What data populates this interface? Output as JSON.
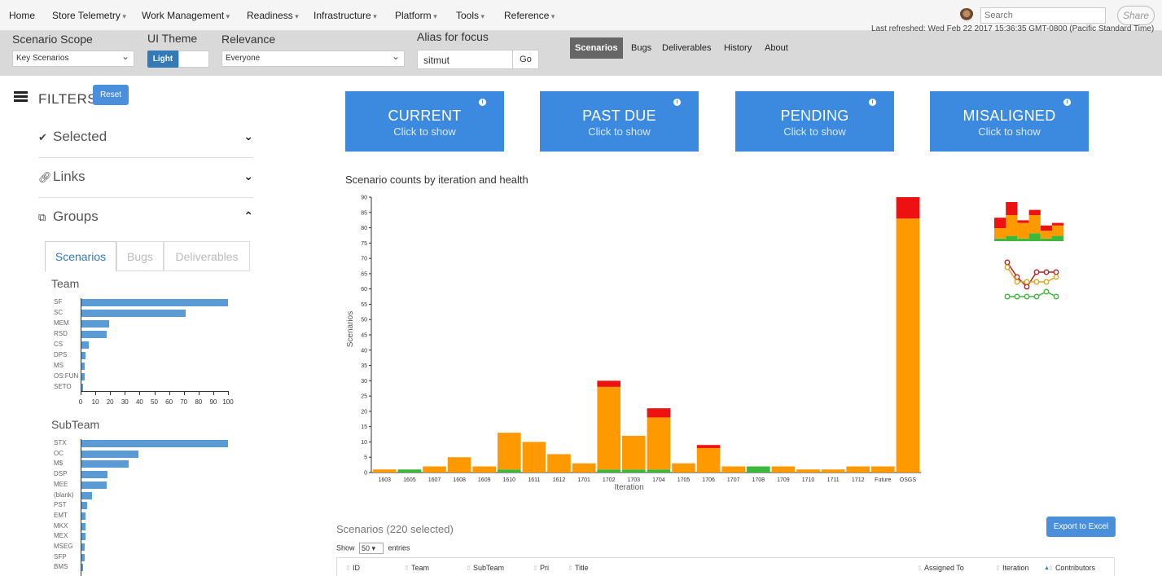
{
  "nav": {
    "items": [
      {
        "label": "Home",
        "dropdown": false
      },
      {
        "label": "Store Telemetry",
        "dropdown": true
      },
      {
        "label": "Work Management",
        "dropdown": true
      },
      {
        "label": "Readiness",
        "dropdown": true
      },
      {
        "label": "Infrastructure",
        "dropdown": true
      },
      {
        "label": "Platform",
        "dropdown": true
      },
      {
        "label": "Tools",
        "dropdown": true
      },
      {
        "label": "Reference",
        "dropdown": true
      }
    ],
    "search_placeholder": "Search",
    "share_label": "Share"
  },
  "toolbar": {
    "scope_label": "Scenario Scope",
    "scope_value": "Key Scenarios",
    "theme_label": "UI Theme",
    "theme_light": "Light",
    "relevance_label": "Relevance",
    "relevance_value": "Everyone",
    "alias_label": "Alias for focus",
    "alias_value": "sitmut",
    "go_label": "Go",
    "views": [
      "Scenarios",
      "Bugs",
      "Deliverables",
      "History",
      "About"
    ],
    "active_view": "Scenarios",
    "last_refreshed": "Last refreshed: Wed Feb 22 2017 15:36:35 GMT-0800 (Pacific Standard Time)"
  },
  "filters": {
    "title": "FILTERS",
    "reset_label": "Reset",
    "sections": [
      "Selected",
      "Links",
      "Groups"
    ],
    "group_tabs": [
      "Scenarios",
      "Bugs",
      "Deliverables"
    ],
    "active_group_tab": "Scenarios",
    "team_title": "Team",
    "team": [
      {
        "label": "SF",
        "value": 100
      },
      {
        "label": "SC",
        "value": 71
      },
      {
        "label": "MEM",
        "value": 19
      },
      {
        "label": "RSD",
        "value": 17
      },
      {
        "label": "CS",
        "value": 5
      },
      {
        "label": "DPS",
        "value": 3
      },
      {
        "label": "MS",
        "value": 2
      },
      {
        "label": "OS:FUN",
        "value": 2
      },
      {
        "label": "SETO",
        "value": 1
      }
    ],
    "team_ticks": [
      "0",
      "10",
      "20",
      "30",
      "40",
      "50",
      "60",
      "70",
      "80",
      "90",
      "100"
    ],
    "subteam_title": "SubTeam",
    "subteam": [
      {
        "label": "STX",
        "value": 100
      },
      {
        "label": "OC",
        "value": 39
      },
      {
        "label": "M$",
        "value": 32
      },
      {
        "label": "DSP",
        "value": 18
      },
      {
        "label": "MEE",
        "value": 17
      },
      {
        "label": "(blank)",
        "value": 7
      },
      {
        "label": "PST",
        "value": 4
      },
      {
        "label": "EMT",
        "value": 3
      },
      {
        "label": "MKX",
        "value": 3
      },
      {
        "label": "MEX",
        "value": 3
      },
      {
        "label": "MSEG",
        "value": 2
      },
      {
        "label": "SFP",
        "value": 2
      },
      {
        "label": "BMS",
        "value": 1
      }
    ]
  },
  "cards": [
    {
      "title": "CURRENT",
      "subtitle": "Click to show"
    },
    {
      "title": "PAST DUE",
      "subtitle": "Click to show"
    },
    {
      "title": "PENDING",
      "subtitle": "Click to show"
    },
    {
      "title": "MISALIGNED",
      "subtitle": "Click to show"
    }
  ],
  "card_info_glyph": "i",
  "chart_data": {
    "type": "bar",
    "stacked": true,
    "title": "Scenario counts by iteration and health",
    "xlabel": "Iteration",
    "ylabel": "Scenarios",
    "ylim": [
      0,
      90
    ],
    "yticks": [
      0,
      5,
      10,
      15,
      20,
      25,
      30,
      35,
      40,
      45,
      50,
      55,
      60,
      65,
      70,
      75,
      80,
      85,
      90
    ],
    "categories": [
      "1603",
      "1605",
      "1607",
      "1608",
      "1609",
      "1610",
      "1611",
      "1612",
      "1701",
      "1702",
      "1703",
      "1704",
      "1705",
      "1706",
      "1707",
      "1708",
      "1709",
      "1710",
      "1711",
      "1712",
      "Future",
      "OSGS"
    ],
    "series": [
      {
        "color": "#3cb83c",
        "values": [
          0,
          1,
          0,
          0,
          0,
          1,
          0,
          0,
          0,
          1,
          1,
          1,
          0,
          0,
          0,
          2,
          0,
          0,
          0,
          0,
          0,
          0
        ]
      },
      {
        "color": "#ff9900",
        "values": [
          1,
          0,
          2,
          5,
          2,
          12,
          10,
          6,
          3,
          27,
          11,
          17,
          3,
          8,
          2,
          0,
          2,
          1,
          1,
          2,
          2,
          83
        ]
      },
      {
        "color": "#ee1111",
        "values": [
          0,
          0,
          0,
          0,
          0,
          0,
          0,
          0,
          0,
          2,
          0,
          3,
          0,
          1,
          0,
          0,
          0,
          0,
          0,
          0,
          0,
          7
        ]
      }
    ],
    "grid": false,
    "legend": "none"
  },
  "sparkline": {
    "bars": [
      {
        "green": 1,
        "orange": 4,
        "red": 4
      },
      {
        "green": 2,
        "orange": 8,
        "red": 5
      },
      {
        "green": 1,
        "orange": 6,
        "red": 1
      },
      {
        "green": 3,
        "orange": 7,
        "red": 2
      },
      {
        "green": 1,
        "orange": 3,
        "red": 2
      },
      {
        "green": 2,
        "orange": 4,
        "red": 1
      }
    ],
    "lines": {
      "red": [
        8,
        5,
        3,
        6,
        6,
        6
      ],
      "orange": [
        7,
        4,
        4,
        4,
        4,
        5
      ],
      "green": [
        1,
        1,
        1,
        1,
        2,
        1
      ]
    }
  },
  "table": {
    "title": "Scenarios (220 selected)",
    "export_label": "Export to Excel",
    "show_prefix": "Show",
    "page_size": "50",
    "show_suffix": "entries",
    "columns": [
      "ID",
      "Team",
      "SubTeam",
      "Pri",
      "Title",
      "Assigned To",
      "Iteration",
      "Contributors"
    ],
    "sorted_column": "Iteration"
  }
}
